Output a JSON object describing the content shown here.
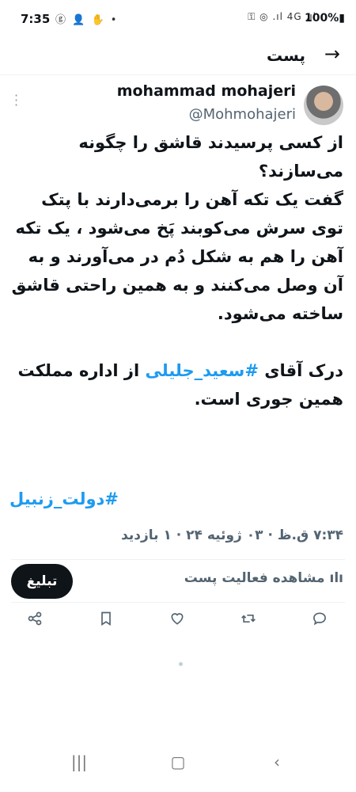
{
  "status_bar": {
    "time": "7:35",
    "left_icons": "ⓖ 👤 ✋ •",
    "right_icons": "⚿ ◎ .ıl 4G .ıl",
    "battery": "100%▮"
  },
  "header": {
    "title": "پست"
  },
  "tweet": {
    "author_name": "mohammad mohajeri",
    "author_handle": "@Mohmohajeri",
    "text_part1": "از کسی پرسیدند قاشق را چگونه می‌سازند؟\nگفت یک تکه آهن را برمی‌دارند با پتک توی سرش می‌کوبند پَخ می‌شود ، یک تکه آهن را هم به شکل دُم در می‌آورند و به آن وصل می‌کنند و به همین راحتی قاشق ساخته می‌شود.\n\nدرک آقای ",
    "text_hashtag": "#سعید_جلیلی",
    "text_part2": " از اداره مملکت همین جوری است.",
    "hashtag_line": "#دولت_زنبیل",
    "meta": "۷:۳۴ ق.ظ · ۰۳ ژوئیه ۲۴ · ۱ بازدید",
    "activity_label": "مشاهده فعالیت پست",
    "promote_label": "تبلیغ"
  },
  "icons": {
    "back": "arrow-right-icon",
    "more": "more-vertical-icon",
    "share": "share-icon",
    "bookmark": "bookmark-icon",
    "like": "heart-icon",
    "retweet": "retweet-icon",
    "reply": "reply-icon"
  },
  "colors": {
    "accent": "#1d9bf0",
    "text": "#0f1419",
    "muted": "#536471"
  }
}
